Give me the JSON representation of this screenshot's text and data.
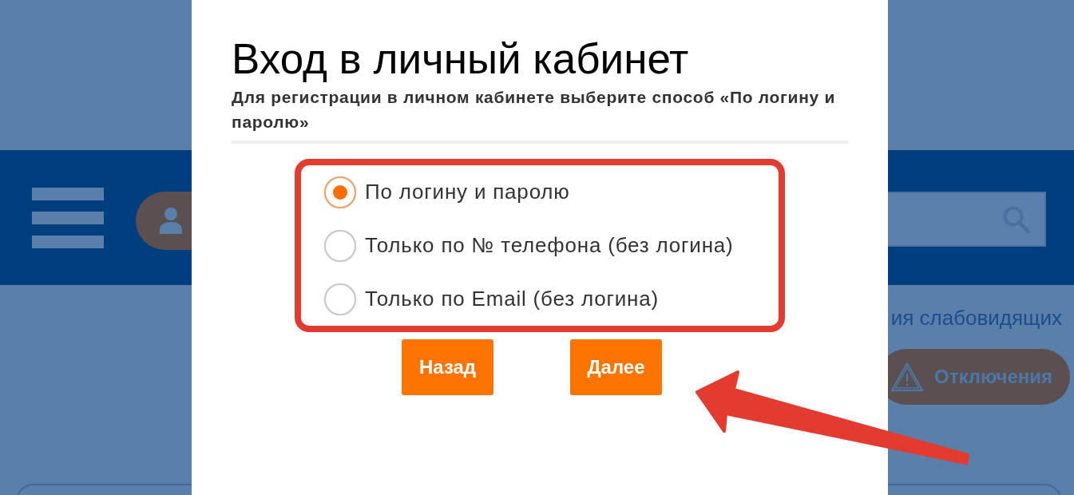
{
  "page": {
    "accessibility_link": "ия слабовидящих",
    "outages_button": "Отключения"
  },
  "dialog": {
    "title": "Вход в личный кабинет",
    "subtitle": "Для регистрации в личном кабинете выберите способ «По логину и паролю»",
    "options": [
      {
        "label": "По логину и паролю",
        "selected": true
      },
      {
        "label": "Только по № телефона (без логина)",
        "selected": false
      },
      {
        "label": "Только по Email (без логина)",
        "selected": false
      }
    ],
    "buttons": [
      "Назад",
      "Далее"
    ]
  }
}
